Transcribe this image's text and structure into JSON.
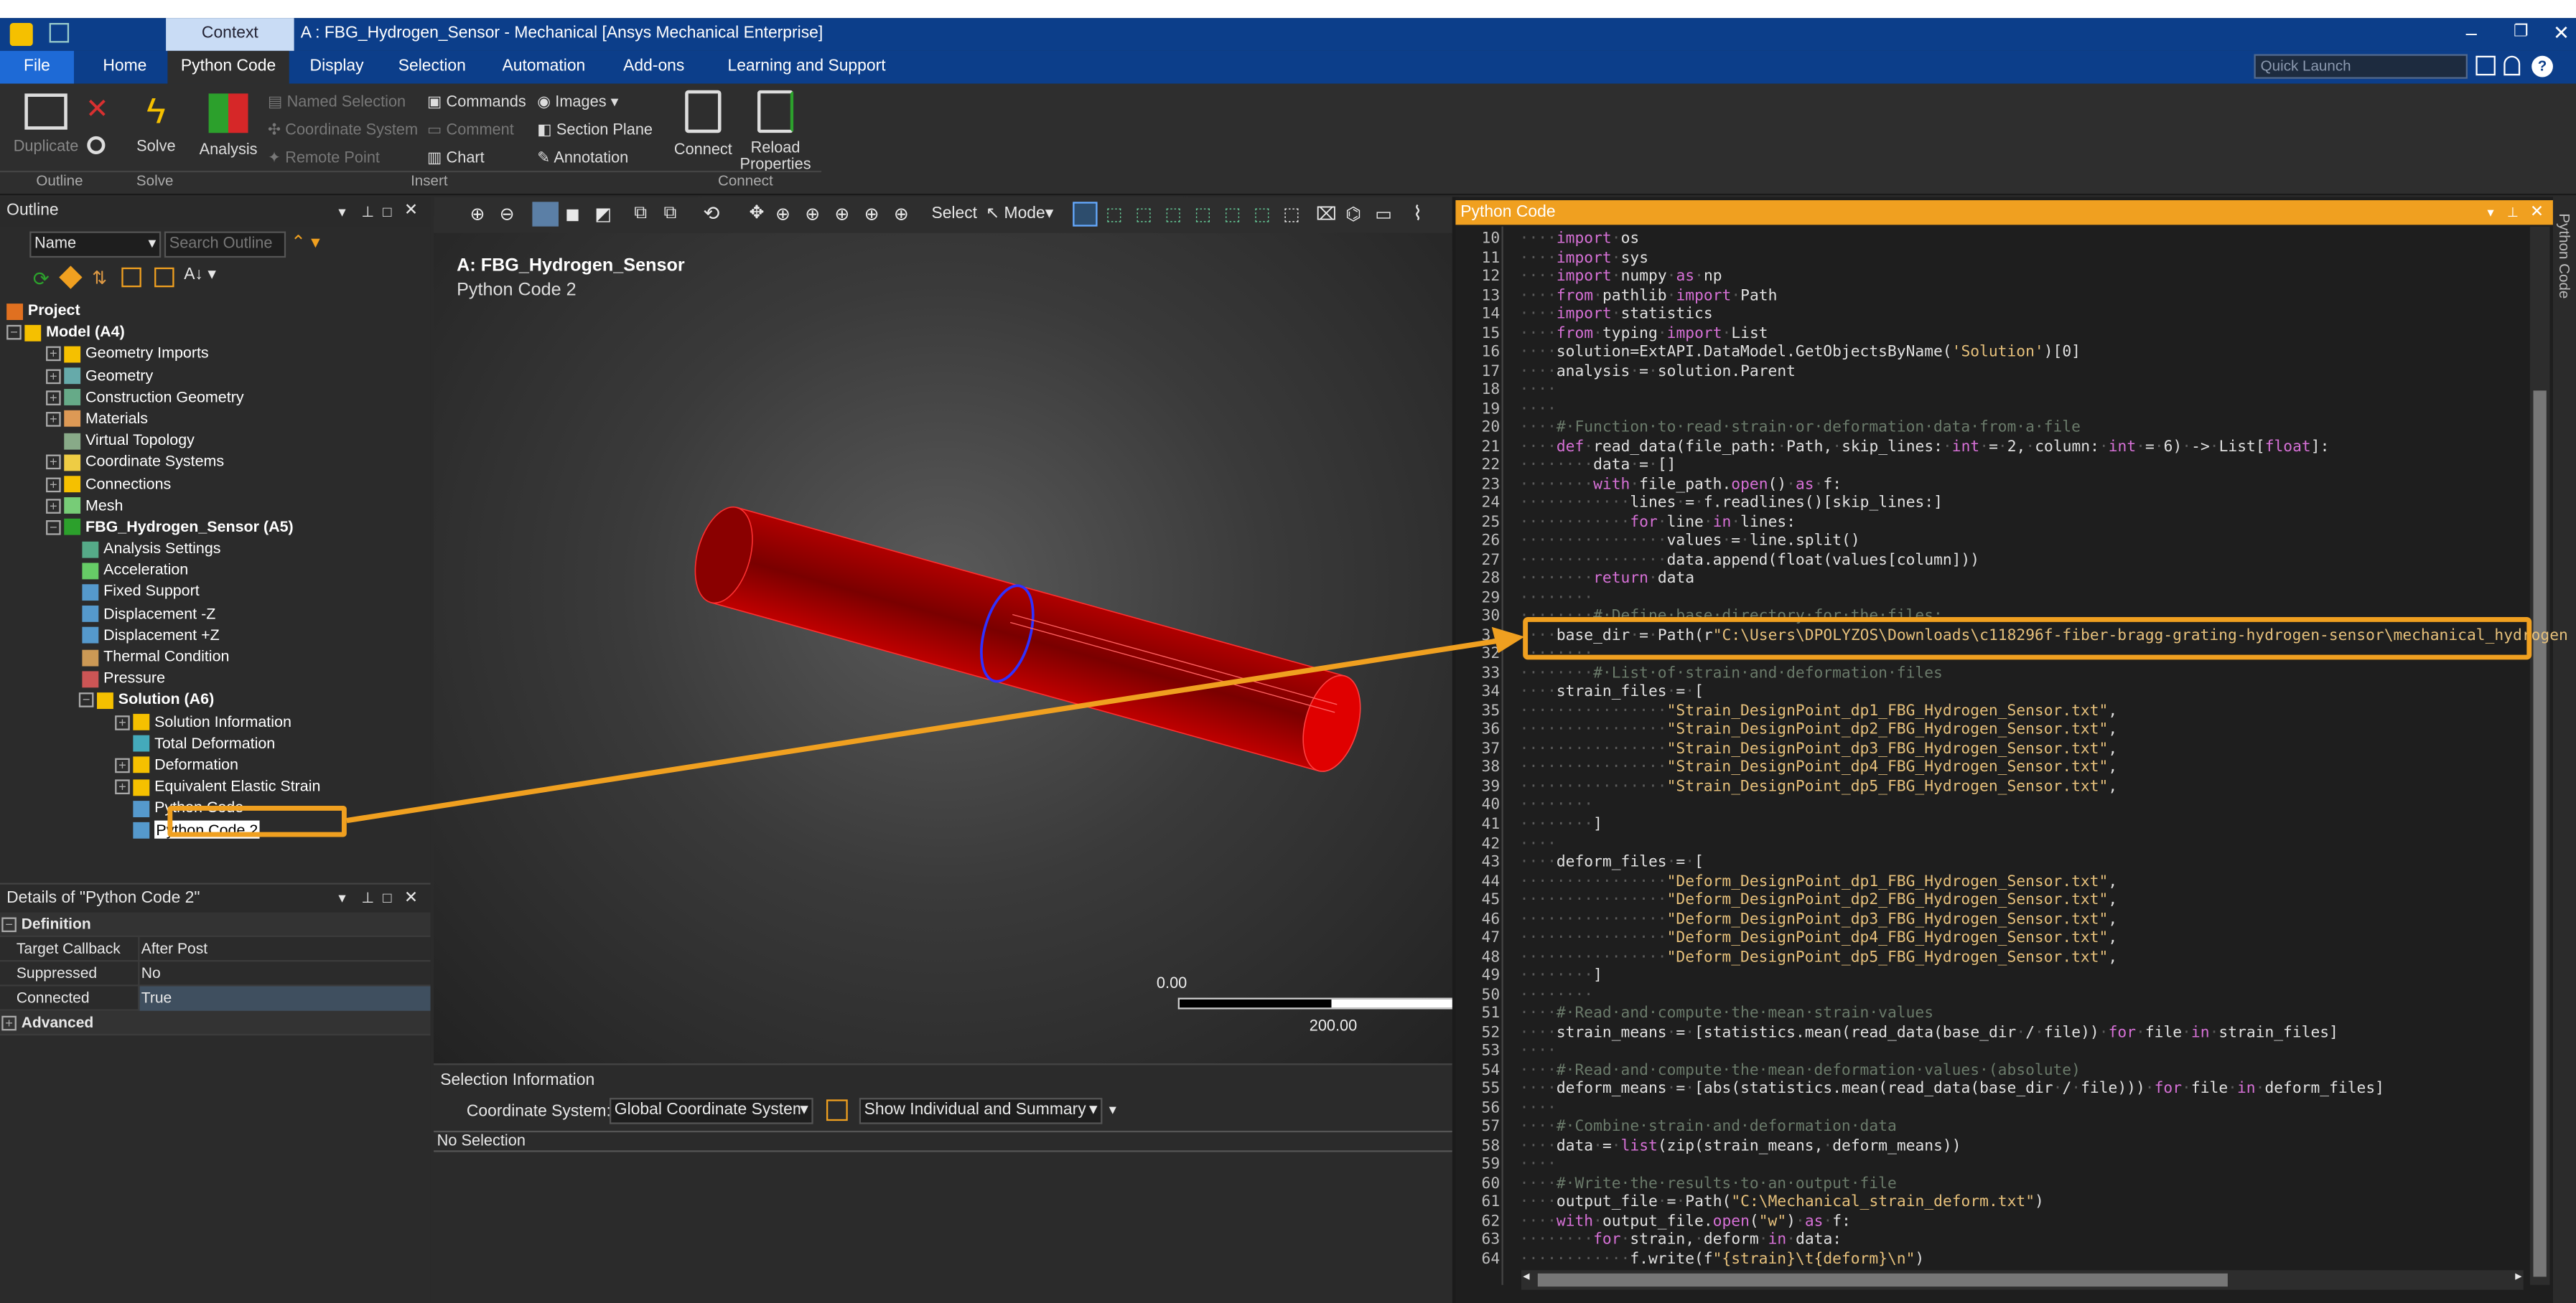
{
  "window": {
    "title": "A : FBG_Hydrogen_Sensor - Mechanical [Ansys Mechanical Enterprise]",
    "context_tab": "Context"
  },
  "ribbon_tabs": [
    "File",
    "Home",
    "Python Code",
    "Display",
    "Selection",
    "Automation",
    "Add-ons",
    "Learning and Support"
  ],
  "quick_launch": "Quick Launch",
  "ribbon": {
    "duplicate": "Duplicate",
    "solve": "Solve",
    "analysis": "Analysis",
    "named_selection": "Named Selection",
    "coordinate_system": "Coordinate System",
    "remote_point": "Remote Point",
    "commands": "Commands",
    "comment": "Comment",
    "chart": "Chart",
    "images": "Images",
    "section_plane": "Section Plane",
    "annotation": "Annotation",
    "connect": "Connect",
    "reload": "Reload",
    "properties": "Properties",
    "groups": {
      "outline": "Outline",
      "solve": "Solve",
      "insert": "Insert",
      "connect": "Connect"
    }
  },
  "outline": {
    "title": "Outline",
    "filter_label": "Name",
    "search_placeholder": "Search Outline",
    "project": "Project",
    "model": "Model (A4)",
    "model_items": [
      "Geometry Imports",
      "Geometry",
      "Construction Geometry",
      "Materials",
      "Virtual Topology",
      "Coordinate Systems",
      "Connections",
      "Mesh"
    ],
    "analysis": "FBG_Hydrogen_Sensor (A5)",
    "analysis_items": [
      "Analysis Settings",
      "Acceleration",
      "Fixed Support",
      "Displacement -Z",
      "Displacement +Z",
      "Thermal Condition",
      "Pressure"
    ],
    "solution": "Solution (A6)",
    "solution_items": [
      "Solution Information",
      "Total Deformation",
      "Deformation",
      "Equivalent Elastic Strain",
      "Python Code",
      "Python Code 2"
    ]
  },
  "details": {
    "title": "Details of \"Python Code 2\"",
    "section": "Definition",
    "rows": [
      {
        "k": "Target Callback",
        "v": "After Post"
      },
      {
        "k": "Suppressed",
        "v": "No"
      },
      {
        "k": "Connected",
        "v": "True"
      }
    ],
    "advanced": "Advanced"
  },
  "viewport": {
    "title": "A: FBG_Hydrogen_Sensor",
    "subtitle": "Python Code 2",
    "select_label": "Select",
    "mode_label": "Mode",
    "scale_min": "0.00",
    "scale_max": "200.00"
  },
  "selection": {
    "title": "Selection Information",
    "cs_label": "Coordinate System:",
    "cs_value": "Global Coordinate System",
    "show_value": "Show Individual and Summary",
    "status": "No Selection"
  },
  "code_panel": {
    "title": "Python Code",
    "side_label": "Python Code",
    "line_numbers": [
      "10",
      "11",
      "12",
      "13",
      "14",
      "15",
      "16",
      "17",
      "18",
      "19",
      "20",
      "21",
      "22",
      "23",
      "24",
      "25",
      "26",
      "27",
      "28",
      "29",
      "30",
      "31",
      "32",
      "33",
      "34",
      "35",
      "36",
      "37",
      "38",
      "39",
      "40",
      "41",
      "42",
      "43",
      "44",
      "45",
      "46",
      "47",
      "48",
      "49",
      "50",
      "51",
      "52",
      "53",
      "54",
      "55",
      "56",
      "57",
      "58",
      "59",
      "60",
      "61",
      "62",
      "63",
      "64"
    ]
  },
  "colors": {
    "title_bar": "#0c3e8a",
    "accent_orange": "#f0a020",
    "code_keyword": "#d670d6",
    "code_string": "#e6c07b",
    "model_red": "#c00000"
  },
  "icons": [
    "close-icon",
    "solve-lightning-icon",
    "search-icon",
    "pin-icon",
    "zoom-icon",
    "help-icon"
  ]
}
